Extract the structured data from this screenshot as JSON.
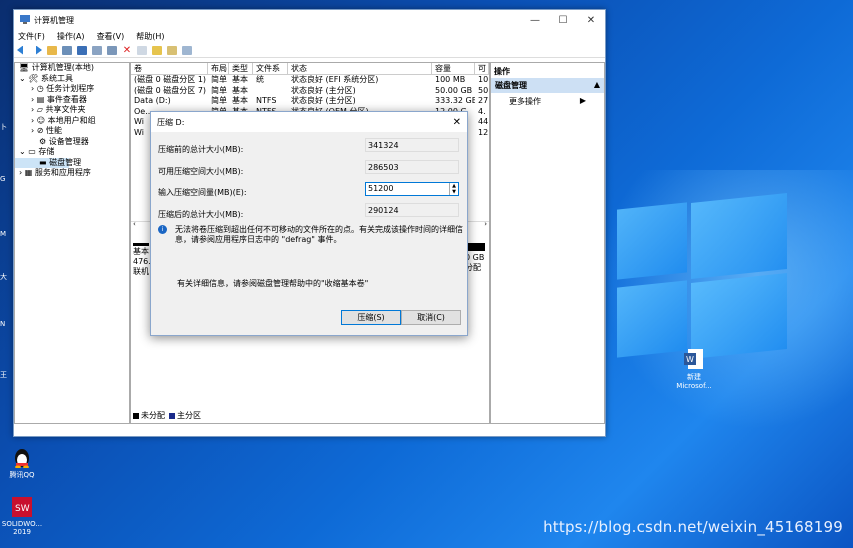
{
  "window": {
    "title": "计算机管理",
    "menu": [
      "文件(F)",
      "操作(A)",
      "查看(V)",
      "帮助(H)"
    ],
    "controls": [
      "—",
      "☐",
      "✕"
    ]
  },
  "tree": {
    "root": "计算机管理(本地)",
    "system_tools": "系统工具",
    "task_scheduler": "任务计划程序",
    "event_viewer": "事件查看器",
    "shared_folders": "共享文件夹",
    "local_users": "本地用户和组",
    "performance": "性能",
    "device_manager": "设备管理器",
    "storage": "存储",
    "disk_management": "磁盘管理",
    "services": "服务和应用程序"
  },
  "volumes": {
    "headers": [
      "卷",
      "布局",
      "类型",
      "文件系统",
      "状态",
      "容量",
      "可"
    ],
    "rows": [
      [
        "(磁盘 0 磁盘分区 1)",
        "简单",
        "基本",
        "",
        "状态良好 (EFI 系统分区)",
        "100 MB",
        "10"
      ],
      [
        "(磁盘 0 磁盘分区 7)",
        "简单",
        "基本",
        "",
        "状态良好 (主分区)",
        "50.00 GB",
        "50"
      ],
      [
        "Data (D:)",
        "简单",
        "基本",
        "NTFS",
        "状态良好 (主分区)",
        "333.32 GB",
        "27"
      ],
      [
        "Oe...",
        "简单",
        "基本",
        "NTFS",
        "状态良好 (OEM 分区)",
        "12.00 G",
        "4."
      ],
      [
        "Wi",
        "",
        "",
        "",
        "",
        "",
        "44"
      ],
      [
        "Wi",
        "",
        "",
        "",
        "",
        "",
        "12"
      ]
    ]
  },
  "disk_panel": {
    "left_lines": [
      "基本",
      "476.",
      "联机"
    ],
    "right_lines": [
      "0 GB",
      "分配"
    ]
  },
  "legend": {
    "unallocated": "未分配",
    "primary": "主分区",
    "unallocated_color": "#000000",
    "primary_color": "#1a2a8a"
  },
  "actions": {
    "header": "操作",
    "selected": "磁盘管理",
    "more": "更多操作"
  },
  "dialog": {
    "title": "压缩 D:",
    "total_before_label": "压缩前的总计大小(MB):",
    "total_before_value": "341324",
    "available_label": "可用压缩空间大小(MB):",
    "available_value": "286503",
    "input_label": "输入压缩空间量(MB)(E):",
    "input_value": "51200",
    "total_after_label": "压缩后的总计大小(MB):",
    "total_after_value": "290124",
    "info_text": "无法将卷压缩到超出任何不可移动的文件所在的点。有关完成该操作时间的详细信息，请参阅应用程序日志中的 \"defrag\" 事件。",
    "help_text": "有关详细信息，请参阅磁盘管理帮助中的\"收缩基本卷\"",
    "shrink_button": "压缩(S)",
    "cancel_button": "取消(C)"
  },
  "desktop": {
    "qq_label": "腾讯QQ",
    "solidworks_label": "SOLIDWO... 2019",
    "word_label": "新建 Microsof...",
    "watermark": "https://blog.csdn.net/weixin_45168199"
  }
}
